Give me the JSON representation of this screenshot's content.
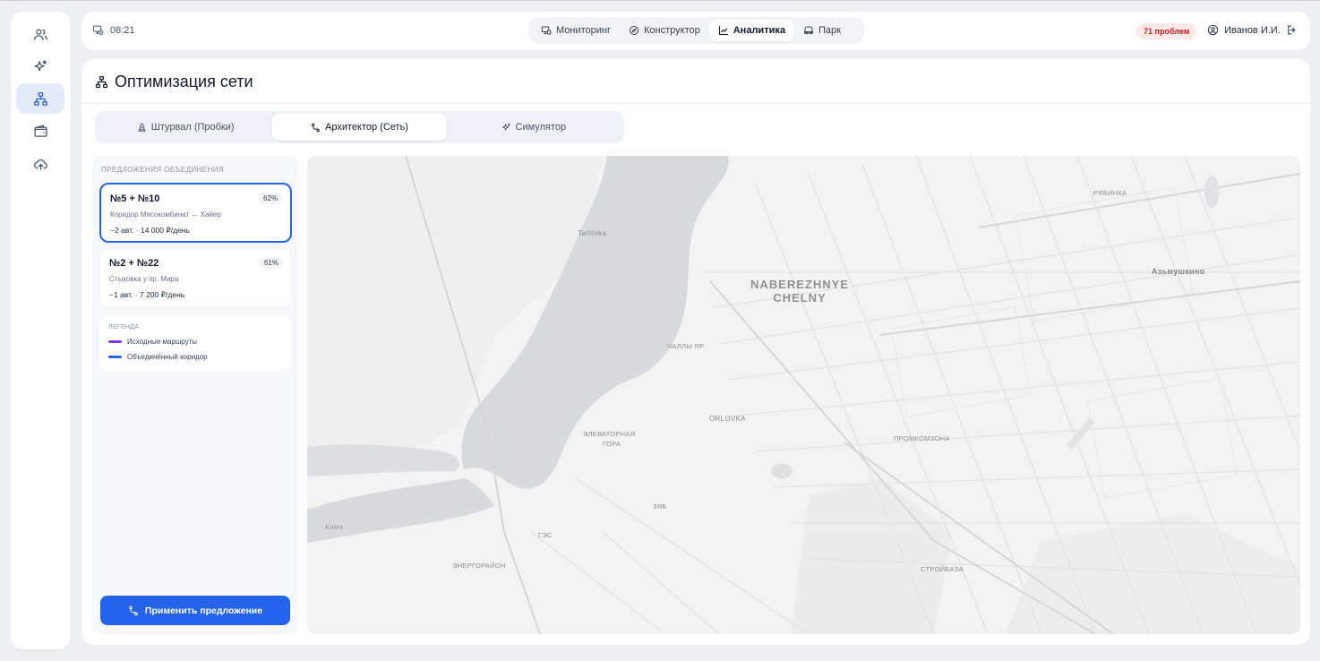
{
  "header": {
    "clock": "08:21",
    "nav": [
      {
        "label": "Мониторинг",
        "icon": "monitor-icon",
        "active": false
      },
      {
        "label": "Конструктор",
        "icon": "compass-icon",
        "active": false
      },
      {
        "label": "Аналитика",
        "icon": "chart-icon",
        "active": true
      },
      {
        "label": "Парк",
        "icon": "bus-icon",
        "active": false
      }
    ],
    "problems_badge": "71 проблем",
    "user_name": "Иванов И.И."
  },
  "page": {
    "title": "Оптимизация сети",
    "mode_tabs": [
      {
        "label": "Штурвал (Пробки)",
        "active": false
      },
      {
        "label": "Архитектор (Сеть)",
        "active": true
      },
      {
        "label": "Симулятор",
        "active": false
      }
    ]
  },
  "side": {
    "heading": "Предложения объединения",
    "proposals": [
      {
        "title": "№5 + №10",
        "percent": "62%",
        "subtitle": "Коридор Мясокомбинат ↔ Хайер",
        "meta": "−2 авт. · 14 000 ₽/день",
        "selected": true
      },
      {
        "title": "№2 + №22",
        "percent": "61%",
        "subtitle": "Стыковка у пр. Мира",
        "meta": "−1 авт. · 7 200 ₽/день",
        "selected": false
      }
    ],
    "legend": {
      "heading": "Легенда",
      "items": [
        {
          "label": "Исходные маршруты",
          "color": "#7c3aed"
        },
        {
          "label": "Объединённый коридор",
          "color": "#2563eb"
        }
      ]
    },
    "apply_label": "Применить предложение"
  },
  "map": {
    "labels": {
      "city_line1": "NABEREZHNYE",
      "city_line2": "CHELNY",
      "tarlovka": "Tarlovka",
      "ryabinka": "РЯБИНКА",
      "azmushkino": "Азьмушкино",
      "chally_yar": "ЧАЛЛЫ ЯР",
      "orlovka": "ORLOVKA",
      "elevatornaya_1": "ЭЛЕВАТОРНАЯ",
      "elevatornaya_2": "ГОРА",
      "promkomzona": "ПРОМКОМЗОНА",
      "zyab": "ЗЯБ",
      "ges": "ГЭС",
      "energorayon": "ЭНЕРГОРАЙОН",
      "stroibaza": "СТРОЙБАЗА",
      "kama": "Кама"
    }
  }
}
